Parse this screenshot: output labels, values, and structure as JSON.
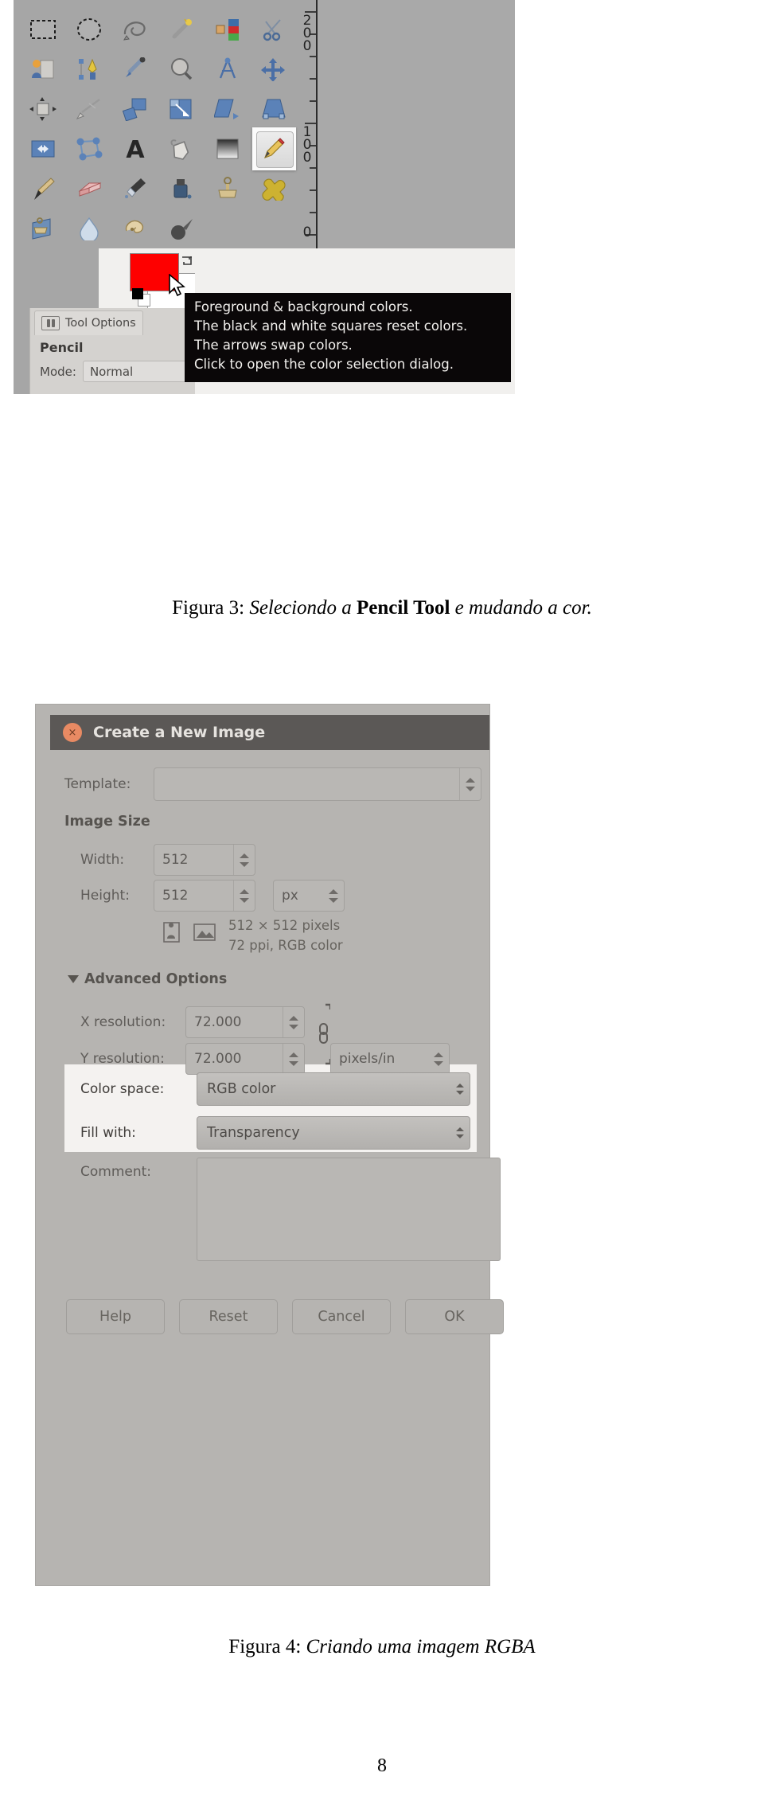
{
  "figure3": {
    "toolbox": {
      "tools": [
        "rectangle-select-tool",
        "ellipse-select-tool",
        "free-select-tool",
        "fuzzy-select-tool",
        "select-by-color-tool",
        "scissors-select-tool",
        "foreground-select-tool",
        "paths-tool",
        "color-picker-tool",
        "zoom-tool",
        "measure-tool",
        "move-tool",
        "alignment-tool",
        "crop-tool",
        "rotate-tool",
        "scale-tool",
        "shear-tool",
        "perspective-tool",
        "flip-tool",
        "cage-transform-tool",
        "text-tool",
        "bucket-fill-tool",
        "blend-gradient-tool",
        "pencil-tool",
        "paintbrush-tool",
        "eraser-tool",
        "airbrush-tool",
        "ink-tool",
        "clone-tool",
        "heal-tool",
        "perspective-clone-tool",
        "blur-sharpen-tool",
        "smudge-tool",
        "dodge-burn-tool"
      ],
      "selected_tool": "pencil-tool"
    },
    "ruler": {
      "labels": [
        "200",
        "100",
        "0"
      ]
    },
    "colors": {
      "foreground": "#FE0000",
      "background": "#FFFFFF"
    },
    "tooltip": {
      "lines": [
        "Foreground & background colors.",
        "The black and white squares reset colors.",
        "The arrows swap colors.",
        "Click to open the color selection dialog."
      ],
      "background": "#0A0708",
      "text_color": "#F3F1EE"
    },
    "tool_options": {
      "dock_tab_label": "Tool Options",
      "title": "Pencil",
      "mode_label": "Mode:",
      "mode_value": "Normal"
    }
  },
  "caption3": {
    "label": "Figura 3:",
    "italic_part1": "Seleciondo a",
    "bold_part": "Pencil Tool",
    "italic_part2": "e mudando a cor."
  },
  "figure4": {
    "title": "Create a New Image",
    "close_icon": "×",
    "template": {
      "label": "Template:",
      "value": ""
    },
    "image_size": {
      "section_label": "Image Size",
      "width_label": "Width:",
      "width_value": "512",
      "height_label": "Height:",
      "height_value": "512",
      "unit_value": "px",
      "info_line1": "512 × 512 pixels",
      "info_line2": "72 ppi, RGB color"
    },
    "advanced": {
      "section_label": "Advanced Options",
      "expander": "▼",
      "x_res_label": "X resolution:",
      "x_res_value": "72.000",
      "y_res_label": "Y resolution:",
      "y_res_value": "72.000",
      "res_unit_value": "pixels/in",
      "color_space_label": "Color space:",
      "color_space_value": "RGB color",
      "fill_with_label": "Fill with:",
      "fill_with_value": "Transparency",
      "comment_label": "Comment:",
      "comment_value": ""
    },
    "buttons": {
      "help": "Help",
      "reset": "Reset",
      "cancel": "Cancel",
      "ok": "OK"
    },
    "highlight_color": "#F4F2F0",
    "titlebar_color": "#5B5856",
    "dialog_bg": "#B6B4B1"
  },
  "caption4": {
    "label": "Figura 4:",
    "italic_part": "Criando uma imagem RGBA"
  },
  "page_number": "8"
}
